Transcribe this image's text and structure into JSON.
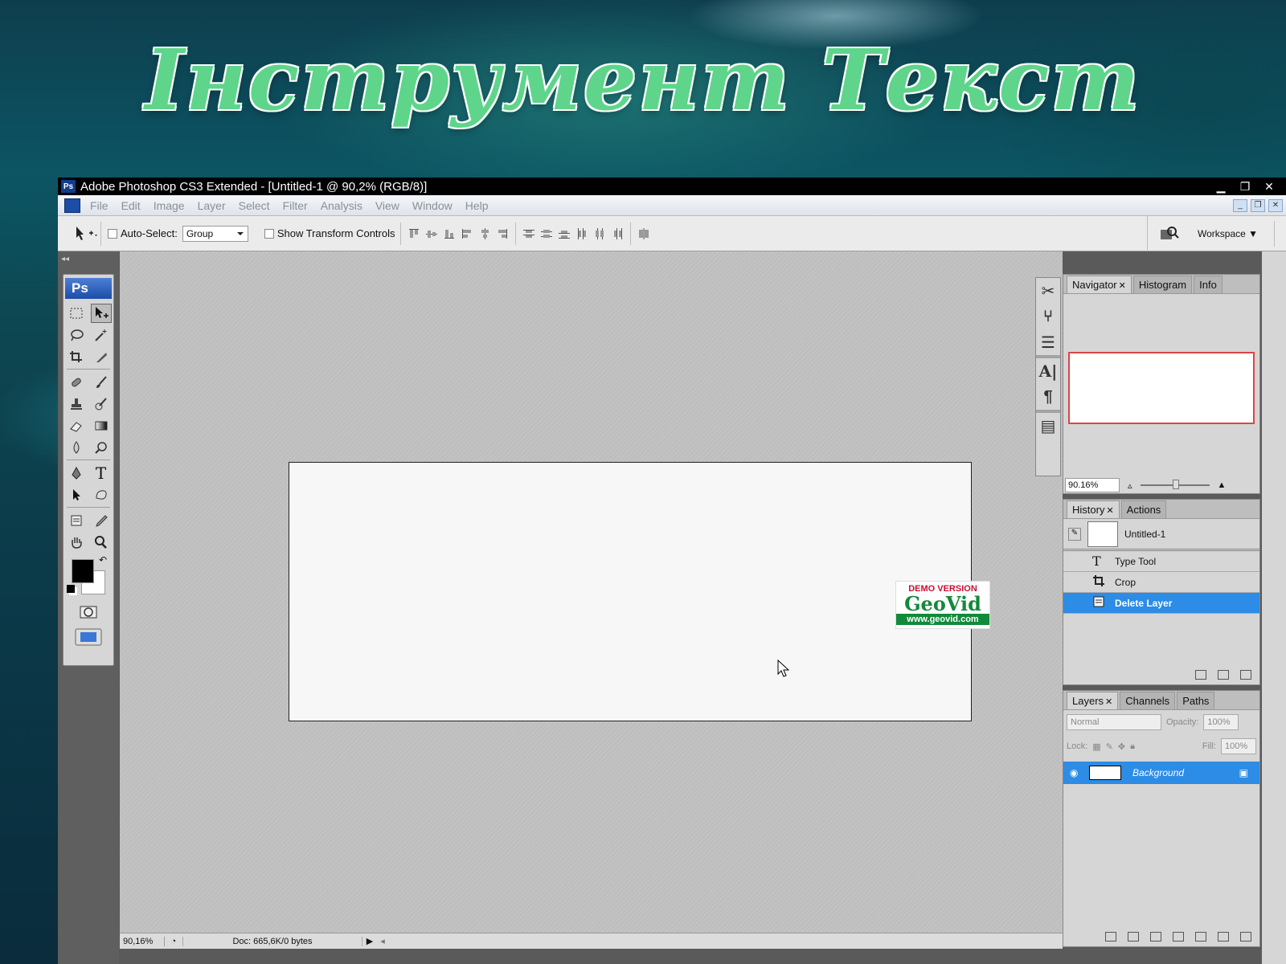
{
  "slide_title": "Інструмент  Текст",
  "window": {
    "title": "Adobe Photoshop CS3 Extended - [Untitled-1 @ 90,2% (RGB/8)]",
    "app_icon_text": "Ps"
  },
  "menu": [
    "File",
    "Edit",
    "Image",
    "Layer",
    "Select",
    "Filter",
    "Analysis",
    "View",
    "Window",
    "Help"
  ],
  "options": {
    "auto_select_label": "Auto-Select:",
    "auto_select_value": "Group",
    "show_transform_label": "Show Transform Controls",
    "workspace_label": "Workspace ▼"
  },
  "toolbox": {
    "header": "Ps"
  },
  "watermark": {
    "demo": "DEMO VERSION",
    "brand": "GeoVid",
    "url": "www.geovid.com"
  },
  "status": {
    "zoom": "90,16%",
    "doc": "Doc: 665,6K/0 bytes"
  },
  "navigator": {
    "tabs": [
      "Navigator",
      "Histogram",
      "Info"
    ],
    "zoom": "90.16%"
  },
  "history": {
    "tabs": [
      "History",
      "Actions"
    ],
    "snapshot": "Untitled-1",
    "steps": [
      {
        "label": "Type Tool",
        "icon": "type-icon",
        "selected": false
      },
      {
        "label": "Crop",
        "icon": "crop-icon",
        "selected": false
      },
      {
        "label": "Delete Layer",
        "icon": "delete-layer-icon",
        "selected": true
      }
    ]
  },
  "layers": {
    "tabs": [
      "Layers",
      "Channels",
      "Paths"
    ],
    "blend_mode": "Normal",
    "opacity_label": "Opacity:",
    "opacity": "100%",
    "lock_label": "Lock:",
    "fill_label": "Fill:",
    "fill": "100%",
    "layer_name": "Background"
  },
  "colors": {
    "title_green": "#5ed58a",
    "selection_blue": "#2c8ce6",
    "ps_blue": "#1c4ea8"
  }
}
